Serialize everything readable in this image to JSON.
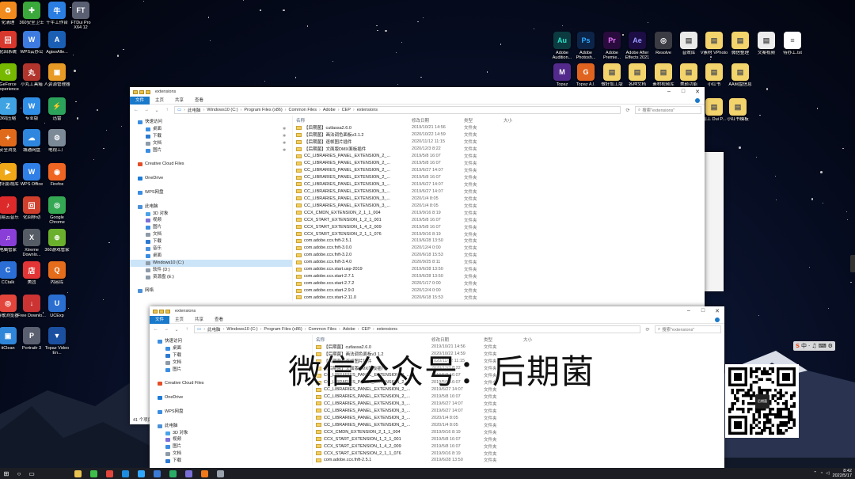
{
  "desktop_left": [
    {
      "label": "化清理",
      "color": "#f28b1d",
      "glyph": "♻"
    },
    {
      "label": "360安全卫士",
      "color": "#3aa83a",
      "glyph": "✚"
    },
    {
      "label": "千牛工作台",
      "color": "#2a7de1",
      "glyph": "牛"
    },
    {
      "label": "FTDui Pro X64 12",
      "color": "#5a5f72",
      "glyph": "FT"
    },
    {
      "label": "化回系统",
      "color": "#d8372e",
      "glyph": "回"
    },
    {
      "label": "WPS云办公",
      "color": "#3d7be0",
      "glyph": "W"
    },
    {
      "label": "AgisoAlle...",
      "color": "#1a5fb4",
      "glyph": "A"
    },
    {
      "label": "XX杀毒",
      "color": "#e0681b",
      "glyph": "X"
    },
    {
      "label": "GeForce Experience",
      "color": "#76b900",
      "glyph": "G"
    },
    {
      "label": "小丸工具箱",
      "color": "#b1352d",
      "glyph": "丸"
    },
    {
      "label": "人资源管理器",
      "color": "#e79a24",
      "glyph": "▣"
    },
    {
      "label": "惠普打印",
      "color": "#0a7ac9",
      "glyph": "⎙"
    },
    {
      "label": "360压缩",
      "color": "#3fa3e3",
      "glyph": "Z"
    },
    {
      "label": "专业版",
      "color": "#2f8ee5",
      "glyph": "W"
    },
    {
      "label": "迅雷",
      "color": "#2ca35b",
      "glyph": "⚡"
    },
    {
      "label": "回收站",
      "color": "#b8c4d0",
      "glyph": "🗑"
    },
    {
      "label": "安全浏览",
      "color": "#e06a1c",
      "glyph": "✦"
    },
    {
      "label": "城通网盘",
      "color": "#2e86de",
      "glyph": "☁"
    },
    {
      "label": "电视工厂",
      "color": "#7c8a98",
      "glyph": "⚙"
    },
    {
      "label": "腾讯QQ",
      "color": "#1c8be0",
      "glyph": "Q"
    },
    {
      "label": "腾讯影视库",
      "color": "#f0a818",
      "glyph": "▶"
    },
    {
      "label": "WPS Office",
      "color": "#2f7fe6",
      "glyph": "W"
    },
    {
      "label": "Firefox",
      "color": "#f06522",
      "glyph": "◉"
    },
    {
      "label": "setaLight 3D v2.5",
      "color": "#4a4f60",
      "glyph": "S"
    },
    {
      "label": "网易云音乐",
      "color": "#dc2a2a",
      "glyph": "♪"
    },
    {
      "label": "化回移动",
      "color": "#d03f2c",
      "glyph": "回"
    },
    {
      "label": "Google Chrome",
      "color": "#34a853",
      "glyph": "◎"
    },
    {
      "label": "腾讯视频",
      "color": "#1da0f2",
      "glyph": "▶"
    },
    {
      "label": "电脑管家",
      "color": "#8a3ed8",
      "glyph": "♫"
    },
    {
      "label": "Xtreme Downlo...",
      "color": "#555c66",
      "glyph": "X"
    },
    {
      "label": "360游戏管家",
      "color": "#6bb02d",
      "glyph": "⊕"
    },
    {
      "label": "腾讯",
      "color": "#1aa34a",
      "glyph": "W"
    },
    {
      "label": "CCtalk",
      "color": "#2b6fd6",
      "glyph": "C"
    },
    {
      "label": "美团",
      "color": "#e33535",
      "glyph": "店"
    },
    {
      "label": "内容库",
      "color": "#e46c1b",
      "glyph": "Q"
    },
    {
      "label": "Adobe Creati...",
      "color": "#d8262c",
      "glyph": "Cc"
    },
    {
      "label": "谷歌浏览器",
      "color": "#e2453b",
      "glyph": "◎"
    },
    {
      "label": "Free Downlo...",
      "color": "#c33",
      "glyph": "↓"
    },
    {
      "label": "UCExp",
      "color": "#2a6fd0",
      "glyph": "U"
    },
    {
      "label": "AfterCodecs",
      "color": "#1d3e7a",
      "glyph": "A"
    },
    {
      "label": "itClean",
      "color": "#2f86d9",
      "glyph": "▣"
    },
    {
      "label": "Portraitr 3",
      "color": "#5b6070",
      "glyph": "P"
    },
    {
      "label": "Topaz Video En...",
      "color": "#1b4fa0",
      "glyph": "▼"
    }
  ],
  "desktop_right": [
    {
      "label": "Adobe Audition...",
      "color": "#0b3b40",
      "glyph": "Au",
      "fg": "#2de0c8"
    },
    {
      "label": "Adobe Photosh...",
      "color": "#0c2447",
      "glyph": "Ps",
      "fg": "#31a8ff"
    },
    {
      "label": "Adobe Premie...",
      "color": "#2a0b3d",
      "glyph": "Pr",
      "fg": "#ea77ff"
    },
    {
      "label": "Adobe After Effects 2021",
      "color": "#1c0d44",
      "glyph": "Ae",
      "fg": "#9999ff"
    },
    {
      "label": "Resolve",
      "color": "#3b3b44",
      "glyph": "◎",
      "fg": "#ffffff"
    },
    {
      "label": "音效库",
      "color": "#e9e9e9",
      "glyph": "▤",
      "fg": "#555"
    },
    {
      "label": "V素材 VPhoto",
      "color": "#f3d36b",
      "glyph": "▤",
      "fg": "#555"
    },
    {
      "label": "微信整理",
      "color": "#f3d36b",
      "glyph": "▤",
      "fg": "#555"
    },
    {
      "label": "文案视频",
      "color": "#ececec",
      "glyph": "▤",
      "fg": "#555"
    },
    {
      "label": "待办工.txt",
      "color": "#ffffff",
      "glyph": "≡",
      "fg": "#555"
    },
    {
      "label": "Topaz",
      "color": "#532a8c",
      "glyph": "M",
      "fg": "#ffffff"
    },
    {
      "label": "Topaz A.I.",
      "color": "#e0641f",
      "glyph": "G",
      "fg": "#ffffff"
    },
    {
      "label": "做好加工版",
      "color": "#f3d36b",
      "glyph": "▤",
      "fg": "#555"
    },
    {
      "label": "各种文档",
      "color": "#f3d36b",
      "glyph": "▤",
      "fg": "#555"
    },
    {
      "label": "素材视频库",
      "color": "#f3d36b",
      "glyph": "▤",
      "fg": "#555"
    },
    {
      "label": "美颜功能",
      "color": "#f3d36b",
      "glyph": "▤",
      "fg": "#555"
    },
    {
      "label": "小红书",
      "color": "#f3d36b",
      "glyph": "▤",
      "fg": "#555"
    },
    {
      "label": "AA网盘信息",
      "color": "#f3d36b",
      "glyph": "▤",
      "fg": "#555"
    },
    {
      "label": "加工 Dui P...",
      "color": "#f3d36b",
      "glyph": "▤",
      "fg": "#555"
    },
    {
      "label": "小红书模板",
      "color": "#f3d36b",
      "glyph": "▤",
      "fg": "#555"
    }
  ],
  "window1": {
    "title": "extensions",
    "tabs": [
      "文件",
      "主页",
      "共享",
      "查看"
    ],
    "path": [
      "此电脑",
      "Windows10 (C:)",
      "Program Files (x86)",
      "Common Files",
      "Adobe",
      "CEP",
      "extensions"
    ],
    "search_placeholder": "搜索\"extensions\"",
    "status": "41 个项目",
    "columns": [
      "名称",
      "修改日期",
      "类型",
      "大小"
    ],
    "nav": [
      {
        "label": "快速访问",
        "color": "#3a8de0",
        "pin": ""
      },
      {
        "label": "桌面",
        "color": "#3a8de0",
        "pin": "✱"
      },
      {
        "label": "下载",
        "color": "#2b79d1",
        "pin": "✱"
      },
      {
        "label": "文档",
        "color": "#8d9aa8",
        "pin": "✱"
      },
      {
        "label": "图片",
        "color": "#3a8de0",
        "pin": "✱"
      },
      {
        "label": "",
        "color": "transparent",
        "pin": ""
      },
      {
        "label": "Creative Cloud Files",
        "color": "#e44d26",
        "pin": ""
      },
      {
        "label": "",
        "color": "transparent",
        "pin": ""
      },
      {
        "label": "OneDrive",
        "color": "#1c7bd6",
        "pin": ""
      },
      {
        "label": "",
        "color": "transparent",
        "pin": ""
      },
      {
        "label": "WPS网盘",
        "color": "#3a8de0",
        "pin": ""
      },
      {
        "label": "",
        "color": "transparent",
        "pin": ""
      },
      {
        "label": "此电脑",
        "color": "#4a90d9",
        "pin": ""
      },
      {
        "label": "3D 对象",
        "color": "#4aa3e8",
        "pin": ""
      },
      {
        "label": "视频",
        "color": "#7a6fd8",
        "pin": ""
      },
      {
        "label": "图片",
        "color": "#3a8de0",
        "pin": ""
      },
      {
        "label": "文档",
        "color": "#8d9aa8",
        "pin": ""
      },
      {
        "label": "下载",
        "color": "#2b79d1",
        "pin": ""
      },
      {
        "label": "音乐",
        "color": "#4a90d9",
        "pin": ""
      },
      {
        "label": "桌面",
        "color": "#3a8de0",
        "pin": ""
      },
      {
        "label": "Windows10 (C:)",
        "color": "#8d9aa8",
        "pin": "",
        "selected": true
      },
      {
        "label": "软件 (D:)",
        "color": "#8d9aa8",
        "pin": ""
      },
      {
        "label": "资源盘 (E:)",
        "color": "#8d9aa8",
        "pin": ""
      },
      {
        "label": "",
        "color": "transparent",
        "pin": ""
      },
      {
        "label": "网络",
        "color": "#4a90d9",
        "pin": ""
      }
    ],
    "files": [
      {
        "name": "【后期菌】cutlassa2.6.0",
        "date": "2019/10/21 14:56",
        "type": "文件夹"
      },
      {
        "name": "【后期菌】画法调色面板v3.1.2",
        "date": "2020/10/22 14:59",
        "type": "文件夹"
      },
      {
        "name": "【后期菌】逐帧图片插件",
        "date": "2020/11/12 11:15",
        "type": "文件夹"
      },
      {
        "name": "【后期菌】文面版DMX面板插件",
        "date": "2020/12/3 8:22",
        "type": "文件夹"
      },
      {
        "name": "CC_LIBRARIES_PANEL_EXTENSION_2_...",
        "date": "2019/5/8 16:07",
        "type": "文件夹"
      },
      {
        "name": "CC_LIBRARIES_PANEL_EXTENSION_2_...",
        "date": "2019/5/8 16:07",
        "type": "文件夹"
      },
      {
        "name": "CC_LIBRARIES_PANEL_EXTENSION_2_...",
        "date": "2019/6/27 14:07",
        "type": "文件夹"
      },
      {
        "name": "CC_LIBRARIES_PANEL_EXTENSION_2_...",
        "date": "2019/5/8 16:07",
        "type": "文件夹"
      },
      {
        "name": "CC_LIBRARIES_PANEL_EXTENSION_3_...",
        "date": "2019/6/27 14:07",
        "type": "文件夹"
      },
      {
        "name": "CC_LIBRARIES_PANEL_EXTENSION_3_...",
        "date": "2019/6/27 14:07",
        "type": "文件夹"
      },
      {
        "name": "CC_LIBRARIES_PANEL_EXTENSION_3_...",
        "date": "2020/1/4 8:05",
        "type": "文件夹"
      },
      {
        "name": "CC_LIBRARIES_PANEL_EXTENSION_3_...",
        "date": "2020/1/4 8:05",
        "type": "文件夹"
      },
      {
        "name": "CCX_CMDN_EXTENSION_2_1_1_004",
        "date": "2019/9/16 8:19",
        "type": "文件夹"
      },
      {
        "name": "CCX_START_EXTENSION_1_2_1_001",
        "date": "2019/5/8 16:07",
        "type": "文件夹"
      },
      {
        "name": "CCX_START_EXTENSION_1_4_2_009",
        "date": "2019/5/8 16:07",
        "type": "文件夹"
      },
      {
        "name": "CCX_START_EXTENSION_2_1_1_076",
        "date": "2019/9/16 8:19",
        "type": "文件夹"
      },
      {
        "name": "com.adobe.ccx.fnft-2.5.1",
        "date": "2019/6/28 13:50",
        "type": "文件夹"
      },
      {
        "name": "com.adobe.ccx.fnft-3.0.0",
        "date": "2020/12/4 0:00",
        "type": "文件夹"
      },
      {
        "name": "com.adobe.ccx.fnft-3.2.0",
        "date": "2020/6/18 15:53",
        "type": "文件夹"
      },
      {
        "name": "com.adobe.ccx.fnft-3.4.0",
        "date": "2020/9/25 8:11",
        "type": "文件夹"
      },
      {
        "name": "com.adobe.ccx.start.uxp-2019",
        "date": "2019/6/28 13:50",
        "type": "文件夹"
      },
      {
        "name": "com.adobe.ccx.start-2.7.1",
        "date": "2019/6/28 13:50",
        "type": "文件夹"
      },
      {
        "name": "com.adobe.ccx.start-2.7.2",
        "date": "2020/1/17 0:00",
        "type": "文件夹"
      },
      {
        "name": "com.adobe.ccx.start-2.9.0",
        "date": "2020/12/4 0:00",
        "type": "文件夹"
      },
      {
        "name": "com.adobe.ccx.start-2.11.0",
        "date": "2020/6/18 15:53",
        "type": "文件夹"
      }
    ]
  },
  "window2": {
    "title": "extensions",
    "tabs": [
      "文件",
      "主页",
      "共享",
      "查看"
    ],
    "path": [
      "此电脑",
      "Windows10 (C:)",
      "Program Files (x86)",
      "Common Files",
      "Adobe",
      "CEP",
      "extensions"
    ],
    "search_placeholder": "搜索\"extensions\"",
    "columns": [
      "名称",
      "修改日期",
      "类型",
      "大小"
    ],
    "nav": [
      {
        "label": "快速访问",
        "color": "#3a8de0",
        "pin": ""
      },
      {
        "label": "桌面",
        "color": "#3a8de0",
        "pin": ""
      },
      {
        "label": "下载",
        "color": "#2b79d1",
        "pin": ""
      },
      {
        "label": "文档",
        "color": "#8d9aa8",
        "pin": ""
      },
      {
        "label": "图片",
        "color": "#3a8de0",
        "pin": ""
      },
      {
        "label": "",
        "color": "transparent",
        "pin": ""
      },
      {
        "label": "Creative Cloud Files",
        "color": "#e44d26",
        "pin": ""
      },
      {
        "label": "",
        "color": "transparent",
        "pin": ""
      },
      {
        "label": "OneDrive",
        "color": "#1c7bd6",
        "pin": ""
      },
      {
        "label": "",
        "color": "transparent",
        "pin": ""
      },
      {
        "label": "WPS网盘",
        "color": "#3a8de0",
        "pin": ""
      },
      {
        "label": "",
        "color": "transparent",
        "pin": ""
      },
      {
        "label": "此电脑",
        "color": "#4a90d9",
        "pin": ""
      },
      {
        "label": "3D 对象",
        "color": "#4aa3e8",
        "pin": ""
      },
      {
        "label": "视频",
        "color": "#7a6fd8",
        "pin": ""
      },
      {
        "label": "图片",
        "color": "#3a8de0",
        "pin": ""
      },
      {
        "label": "文档",
        "color": "#8d9aa8",
        "pin": ""
      },
      {
        "label": "下载",
        "color": "#2b79d1",
        "pin": ""
      }
    ],
    "files": [
      {
        "name": "【后期菌】cutlassa2.6.0",
        "date": "2019/10/21 14:56",
        "type": "文件夹"
      },
      {
        "name": "【后期菌】画法调色面板v3.1.2",
        "date": "2020/10/22 14:59",
        "type": "文件夹"
      },
      {
        "name": "【后期菌】逐帧图片插件",
        "date": "2020/11/12 11:15",
        "type": "文件夹"
      },
      {
        "name": "【后期菌】文面版DMX面板插件",
        "date": "2020/12/3 8:22",
        "type": "文件夹"
      },
      {
        "name": "CC_LIBRARIES_PANEL_EXTENSION_2_...",
        "date": "2019/5/8 16:07",
        "type": "文件夹"
      },
      {
        "name": "CC_LIBRARIES_PANEL_EXTENSION_2_...",
        "date": "2019/5/8 16:07",
        "type": "文件夹"
      },
      {
        "name": "CC_LIBRARIES_PANEL_EXTENSION_2_...",
        "date": "2019/6/27 14:07",
        "type": "文件夹"
      },
      {
        "name": "CC_LIBRARIES_PANEL_EXTENSION_2_...",
        "date": "2019/5/8 16:07",
        "type": "文件夹"
      },
      {
        "name": "CC_LIBRARIES_PANEL_EXTENSION_3_...",
        "date": "2019/6/27 14:07",
        "type": "文件夹"
      },
      {
        "name": "CC_LIBRARIES_PANEL_EXTENSION_3_...",
        "date": "2019/6/27 14:07",
        "type": "文件夹"
      },
      {
        "name": "CC_LIBRARIES_PANEL_EXTENSION_3_...",
        "date": "2020/1/4 8:05",
        "type": "文件夹"
      },
      {
        "name": "CC_LIBRARIES_PANEL_EXTENSION_3_...",
        "date": "2020/1/4 8:05",
        "type": "文件夹"
      },
      {
        "name": "CCX_CMDN_EXTENSION_2_1_1_004",
        "date": "2019/9/16 8:19",
        "type": "文件夹"
      },
      {
        "name": "CCX_START_EXTENSION_1_2_1_001",
        "date": "2019/5/8 16:07",
        "type": "文件夹"
      },
      {
        "name": "CCX_START_EXTENSION_1_4_2_009",
        "date": "2019/5/8 16:07",
        "type": "文件夹"
      },
      {
        "name": "CCX_START_EXTENSION_2_1_1_076",
        "date": "2019/9/16 8:19",
        "type": "文件夹"
      },
      {
        "name": "com.adobe.ccx.fnft-2.5.1",
        "date": "2019/6/28 13:50",
        "type": "文件夹"
      }
    ]
  },
  "watermark": "微信公众号：后期菌",
  "qr_logo": "后期菌",
  "ime": [
    "S",
    "中",
    "·",
    "♫",
    "⌨",
    "⚙"
  ],
  "taskbar": {
    "apps": [
      {
        "name": "taskbar-app-explorer",
        "color": "#e8c250"
      },
      {
        "name": "taskbar-app-green",
        "color": "#3fbf4a"
      },
      {
        "name": "taskbar-app-chrome",
        "color": "#e2453b"
      },
      {
        "name": "taskbar-app-qq",
        "color": "#1c8be0"
      },
      {
        "name": "taskbar-app-ps",
        "color": "#31a8ff"
      },
      {
        "name": "taskbar-app-store",
        "color": "#3a7bd5"
      },
      {
        "name": "taskbar-app-wechat",
        "color": "#2aae67"
      },
      {
        "name": "taskbar-app-media",
        "color": "#7a6fd8"
      },
      {
        "name": "taskbar-app-tt",
        "color": "#f07a1b"
      },
      {
        "name": "taskbar-app-gray",
        "color": "#9aa3ad"
      }
    ],
    "time": "8:42",
    "date": "2022/5/17"
  }
}
